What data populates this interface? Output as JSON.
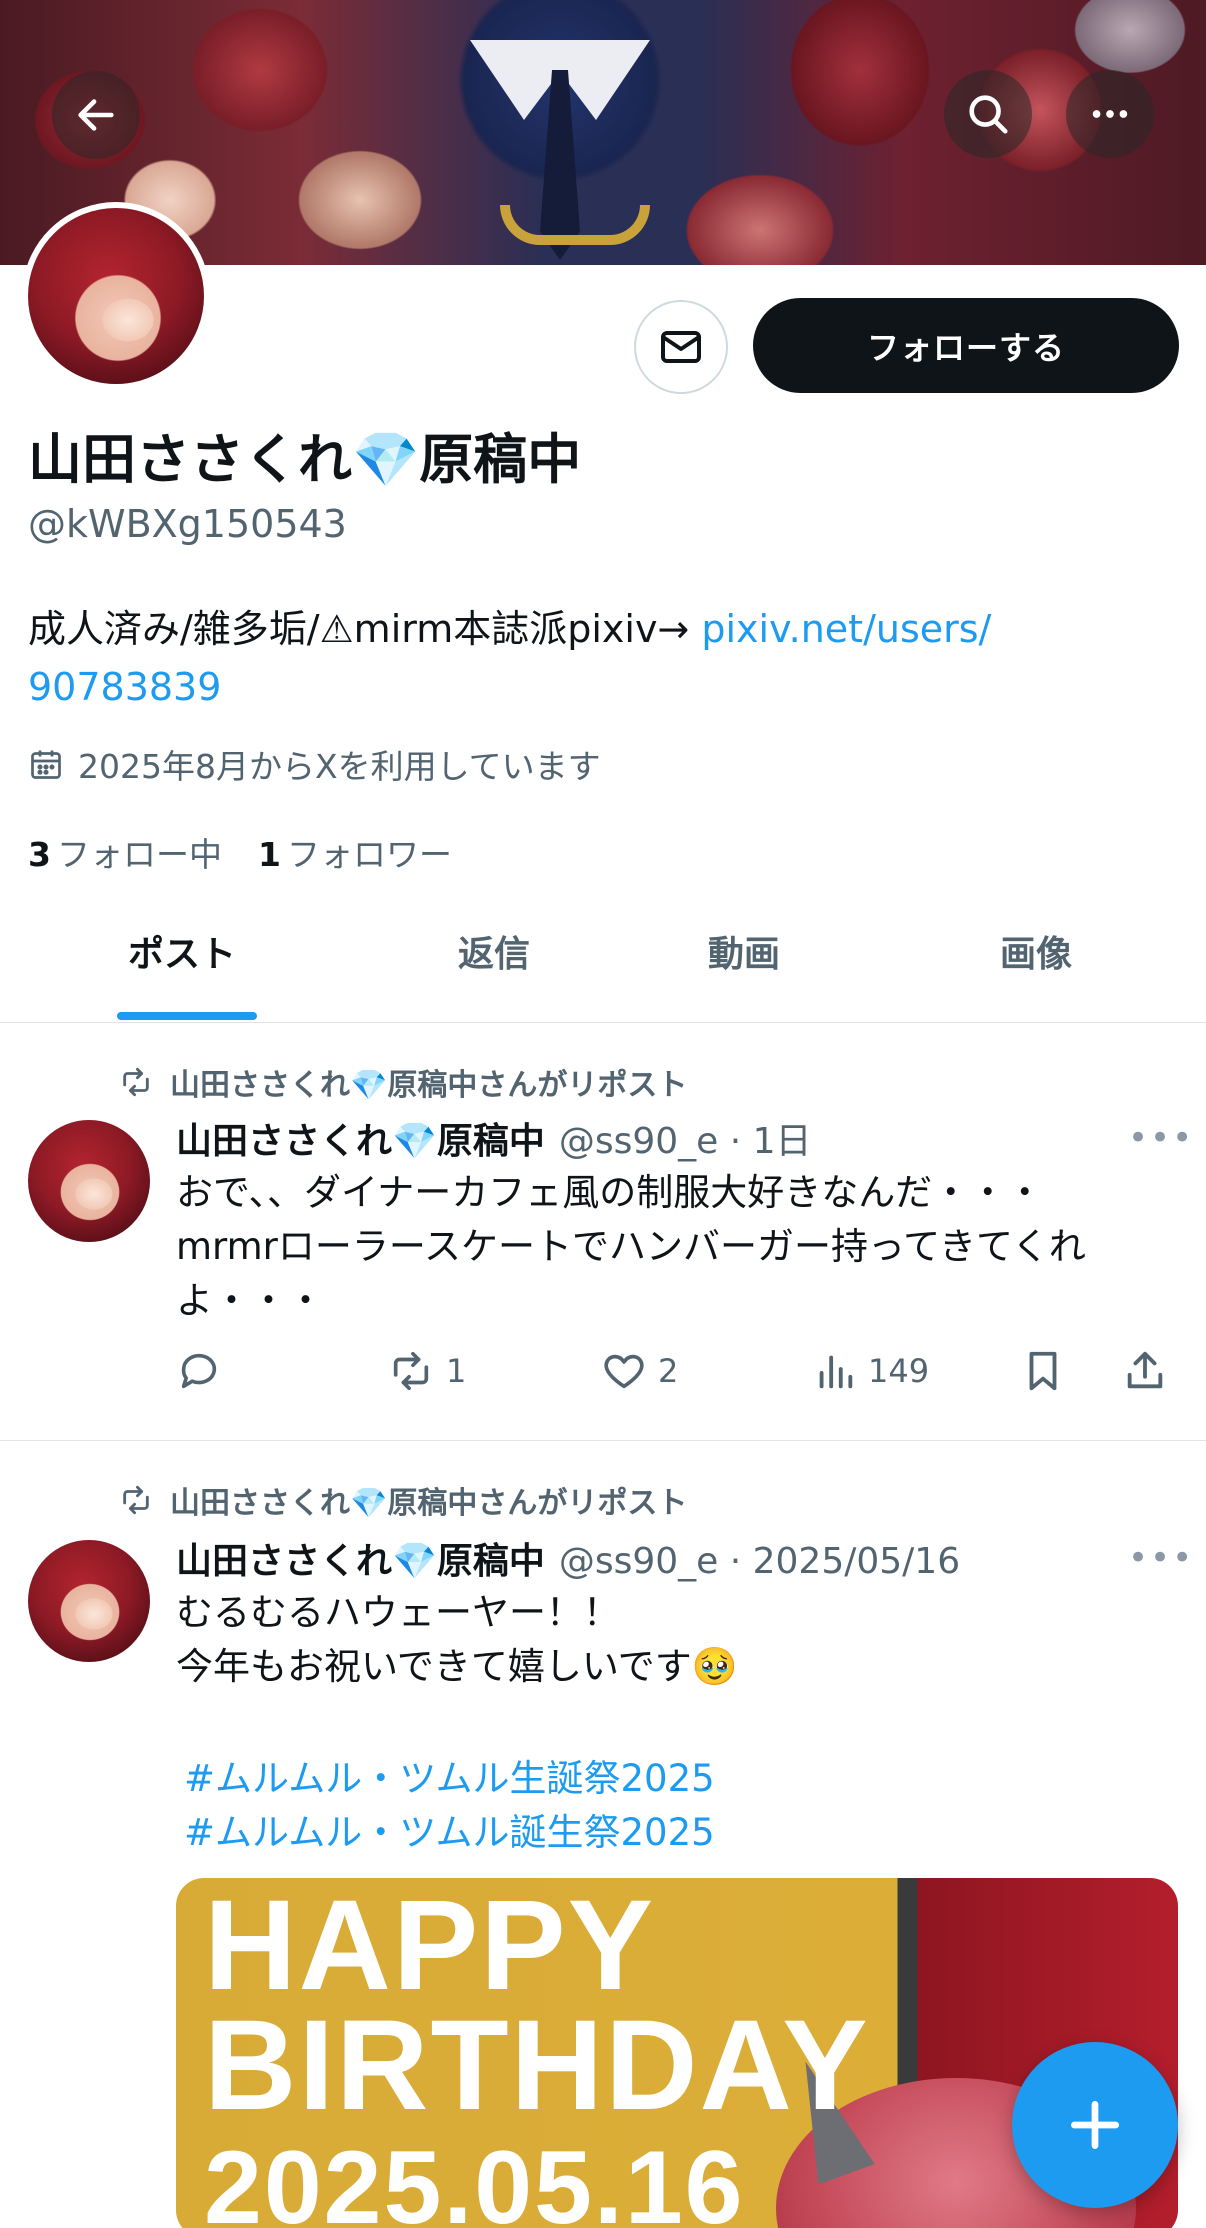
{
  "profile": {
    "display_name": "山田ささくれ💎原稿中",
    "handle": "@kWBXg150543",
    "bio_text": "成人済み/雑多垢/⚠mirm本誌派pixiv→ ",
    "bio_link_1": "pixiv.net/users/",
    "bio_link_2": "90783839",
    "joined": "2025年8月からXを利用しています",
    "following_count": "3",
    "following_label": "フォロー中",
    "followers_count": "1",
    "followers_label": "フォロワー"
  },
  "header": {
    "back_icon": "arrow-left-icon",
    "search_icon": "search-icon",
    "more_icon": "more-horizontal-icon"
  },
  "buttons": {
    "follow_label": "フォローする",
    "message_icon": "envelope-icon"
  },
  "tabs": [
    {
      "label": "ポスト",
      "active": true
    },
    {
      "label": "返信",
      "active": false
    },
    {
      "label": "動画",
      "active": false
    },
    {
      "label": "画像",
      "active": false
    }
  ],
  "posts": [
    {
      "repost_label": "山田ささくれ💎原稿中さんがリポスト",
      "author": "山田ささくれ💎原稿中",
      "handle_time": "@ss90_e · 1日",
      "text": "おで、、ダイナーカフェ風の制服大好きなんだ・・・\nmrmrローラースケートでハンバーガー持ってきてくれよ・・・",
      "replies": "",
      "reposts": "1",
      "likes": "2",
      "views": "149"
    },
    {
      "repost_label": "山田ささくれ💎原稿中さんがリポスト",
      "author": "山田ささくれ💎原稿中",
      "handle_time": "@ss90_e · 2025/05/16",
      "text": "むるむるハウェーヤー！！\n今年もお祝いできて嬉しいです🥹",
      "hashtags": [
        "#ムルムル・ツムル生誕祭2025",
        "#ムルムル・ツムル誕生祭2025"
      ],
      "media_text": [
        "HAPPY",
        "BIRTHDAY",
        "2025.05.16"
      ]
    }
  ],
  "fab": {
    "icon": "plus-icon"
  },
  "colors": {
    "accent": "#1d9bf0",
    "text": "#0f1419",
    "muted": "#536471"
  }
}
